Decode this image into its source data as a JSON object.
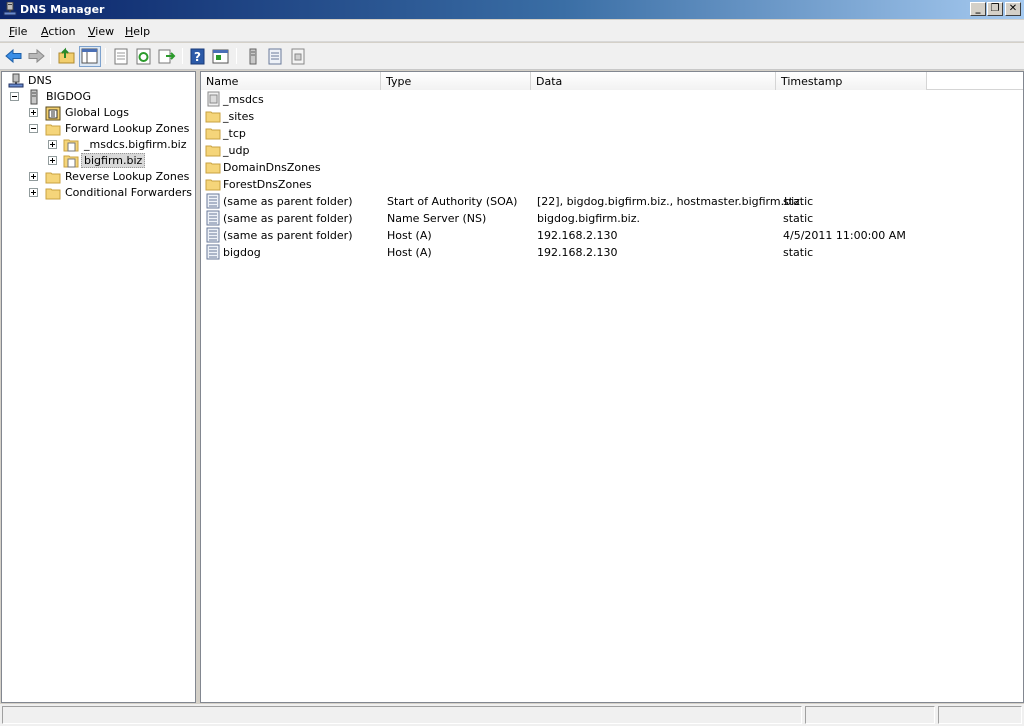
{
  "window": {
    "title": "DNS Manager"
  },
  "menu": [
    {
      "label": "File",
      "accel": "F",
      "rest": "ile"
    },
    {
      "label": "Action",
      "accel": "A",
      "rest": "ction"
    },
    {
      "label": "View",
      "accel": "V",
      "rest": "iew"
    },
    {
      "label": "Help",
      "accel": "H",
      "rest": "elp"
    }
  ],
  "toolbar": {
    "icons": [
      "back-icon",
      "forward-icon",
      "up-folder-icon",
      "show-hide-tree-icon",
      "properties-icon",
      "refresh-icon",
      "export-list-icon",
      "help-icon",
      "show-hide-action-pane-icon",
      "server-icon",
      "host-record-icon",
      "zone-icon"
    ]
  },
  "tree": {
    "items": [
      {
        "label": "DNS",
        "icon": "dns-server-icon"
      },
      {
        "label": "BIGDOG",
        "icon": "server-icon"
      },
      {
        "label": "Global Logs",
        "icon": "logs-icon"
      },
      {
        "label": "Forward Lookup Zones",
        "icon": "folder-icon"
      },
      {
        "label": "_msdcs.bigfirm.biz",
        "icon": "zone-icon"
      },
      {
        "label": "bigfirm.biz",
        "icon": "zone-icon"
      },
      {
        "label": "Reverse Lookup Zones",
        "icon": "folder-icon"
      },
      {
        "label": "Conditional Forwarders",
        "icon": "folder-icon"
      }
    ]
  },
  "list": {
    "columns": [
      "Name",
      "Type",
      "Data",
      "Timestamp"
    ],
    "rows": [
      {
        "name": "_msdcs",
        "type": "",
        "data": "",
        "timestamp": "",
        "icon": "delegation-icon"
      },
      {
        "name": "_sites",
        "type": "",
        "data": "",
        "timestamp": "",
        "icon": "folder-icon"
      },
      {
        "name": "_tcp",
        "type": "",
        "data": "",
        "timestamp": "",
        "icon": "folder-icon"
      },
      {
        "name": "_udp",
        "type": "",
        "data": "",
        "timestamp": "",
        "icon": "folder-icon"
      },
      {
        "name": "DomainDnsZones",
        "type": "",
        "data": "",
        "timestamp": "",
        "icon": "folder-icon"
      },
      {
        "name": "ForestDnsZones",
        "type": "",
        "data": "",
        "timestamp": "",
        "icon": "folder-icon"
      },
      {
        "name": "(same as parent folder)",
        "type": "Start of Authority (SOA)",
        "data": "[22], bigdog.bigfirm.biz., hostmaster.bigfirm.biz.",
        "timestamp": "static",
        "icon": "record-icon"
      },
      {
        "name": "(same as parent folder)",
        "type": "Name Server (NS)",
        "data": "bigdog.bigfirm.biz.",
        "timestamp": "static",
        "icon": "record-icon"
      },
      {
        "name": "(same as parent folder)",
        "type": "Host (A)",
        "data": "192.168.2.130",
        "timestamp": "4/5/2011 11:00:00 AM",
        "icon": "record-icon"
      },
      {
        "name": "bigdog",
        "type": "Host (A)",
        "data": "192.168.2.130",
        "timestamp": "static",
        "icon": "record-icon"
      }
    ]
  }
}
